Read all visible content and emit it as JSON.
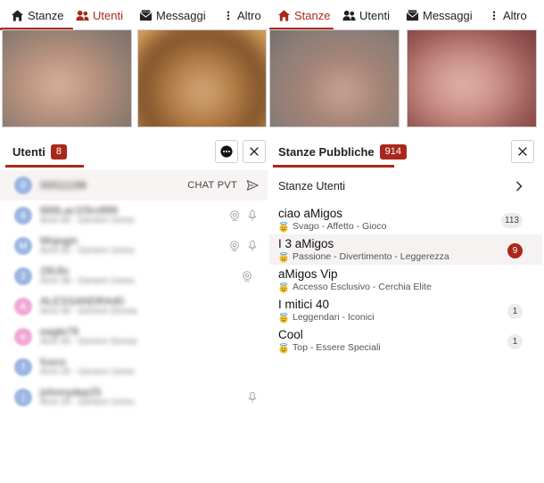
{
  "left": {
    "nav": {
      "items": [
        {
          "label": "Stanze",
          "active": false
        },
        {
          "label": "Utenti",
          "active": true
        },
        {
          "label": "Messaggi",
          "active": false
        },
        {
          "label": "Altro",
          "active": false
        }
      ]
    },
    "section": {
      "title": "Utenti",
      "count": "8"
    },
    "chat_pvt_label": "CHAT PVT",
    "users": [
      {
        "initial": "0",
        "name": "00011199",
        "sub": "",
        "color": "#9cb7e3"
      },
      {
        "initial": "6",
        "name": "666Lac1f3ro999",
        "sub": "Anni 46 - Genere Uomo",
        "color": "#9cb7e3"
      },
      {
        "initial": "M",
        "name": "Mojogin",
        "sub": "Anni 42 - Genere Uomo",
        "color": "#9cb7e3"
      },
      {
        "initial": "2",
        "name": "29Ufo",
        "sub": "Anni 39 - Genere Uomo",
        "color": "#9cb7e3"
      },
      {
        "initial": "A",
        "name": "ALESSANDRA40",
        "sub": "Anni 40 - Genere Donna",
        "color": "#f0a8d6"
      },
      {
        "initial": "e",
        "name": "eagle79",
        "sub": "Anni 45 - Genere Donna",
        "color": "#f0a8d6"
      },
      {
        "initial": "f",
        "name": "fusco",
        "sub": "Anni 25 - Genere Uomo",
        "color": "#9cb7e3"
      },
      {
        "initial": "j",
        "name": "johnnydep25",
        "sub": "Anni 24 - Genere Uomo",
        "color": "#9cb7e3"
      }
    ]
  },
  "right": {
    "nav": {
      "items": [
        {
          "label": "Stanze",
          "active": true
        },
        {
          "label": "Utenti",
          "active": false
        },
        {
          "label": "Messaggi",
          "active": false
        },
        {
          "label": "Altro",
          "active": false
        }
      ]
    },
    "section": {
      "title": "Stanze Pubbliche",
      "count": "914"
    },
    "stanze_utenti_label": "Stanze Utenti",
    "rooms": [
      {
        "name": "ciao aMigos",
        "tags": "Svago - Affetto - Gioco",
        "count": "113",
        "highlight": false
      },
      {
        "name": "I 3 aMigos",
        "tags": "Passione - Divertimento - Leggerezza",
        "count": "9",
        "highlight": true
      },
      {
        "name": "aMigos Vip",
        "tags": "Accesso Esclusivo - Cerchia Elite",
        "count": "",
        "highlight": false
      },
      {
        "name": "I mitici 40",
        "tags": "Leggendari - Iconici",
        "count": "1",
        "highlight": false
      },
      {
        "name": "Cool",
        "tags": "Top - Essere Speciali",
        "count": "1",
        "highlight": false
      }
    ]
  },
  "colors": {
    "accent": "#a8291b",
    "male_avatar": "#9cb7e3",
    "female_avatar": "#f0a8d6"
  }
}
